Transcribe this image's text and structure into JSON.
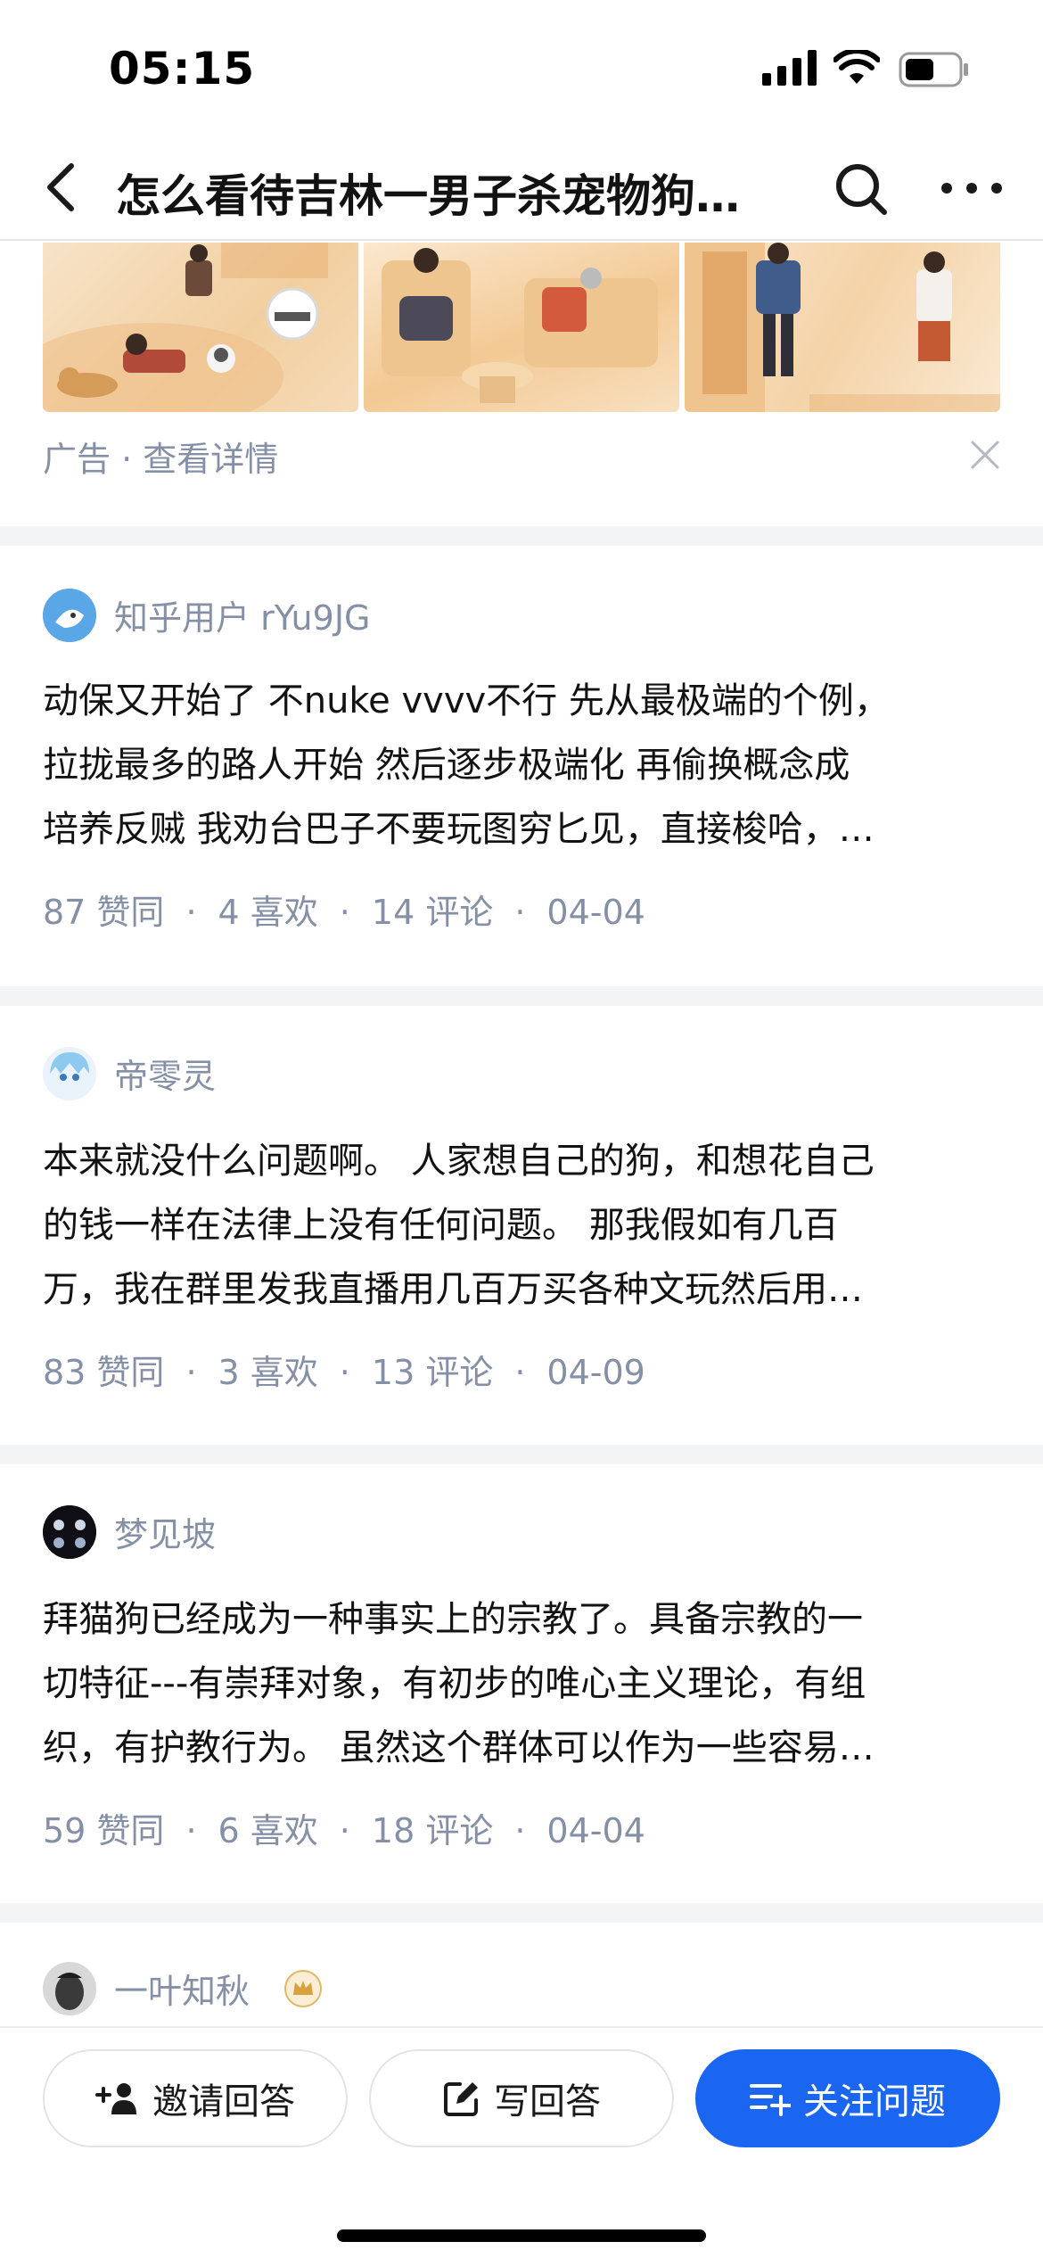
{
  "status_bar": {
    "time": "05:15",
    "battery_level": 0.55
  },
  "header": {
    "title": "怎么看待吉林一男子杀宠物狗…"
  },
  "ad": {
    "label": "广告 · 查看详情"
  },
  "answers": [
    {
      "author": "知乎用户 rYu9JG",
      "lines": [
        "动保又开始了 不nuke vvvv不行 先从最极端的个例，",
        "拉拢最多的路人开始 然后逐步极端化 再偷换概念成",
        "培养反贼 我劝台巴子不要玩图穷匕见，直接梭哈，…"
      ],
      "likes": "87 赞同",
      "favorites": "4 喜欢",
      "comments": "14 评论",
      "date": "04-04"
    },
    {
      "author": "帝零灵",
      "lines": [
        "本来就没什么问题啊。 人家想自己的狗，和想花自己",
        "的钱一样在法律上没有任何问题。 那我假如有几百",
        "万，我在群里发我直播用几百万买各种文玩然后用…"
      ],
      "likes": "83 赞同",
      "favorites": "3 喜欢",
      "comments": "13 评论",
      "date": "04-09"
    },
    {
      "author": "梦见坡",
      "lines": [
        "拜猫狗已经成为一种事实上的宗教了。具备宗教的一",
        "切特征---有崇拜对象，有初步的唯心主义理论，有组",
        "织，有护教行为。 虽然这个群体可以作为一些容易…"
      ],
      "likes": "59 赞同",
      "favorites": "6 喜欢",
      "comments": "18 评论",
      "date": "04-04"
    },
    {
      "author": "一叶知秋"
    }
  ],
  "bottom_bar": {
    "invite_label": "邀请回答",
    "write_label": "写回答",
    "follow_label": "关注问题"
  },
  "colors": {
    "accent": "#1a66f0",
    "meta_text": "#8590a6",
    "divider": "#f3f4f6"
  }
}
